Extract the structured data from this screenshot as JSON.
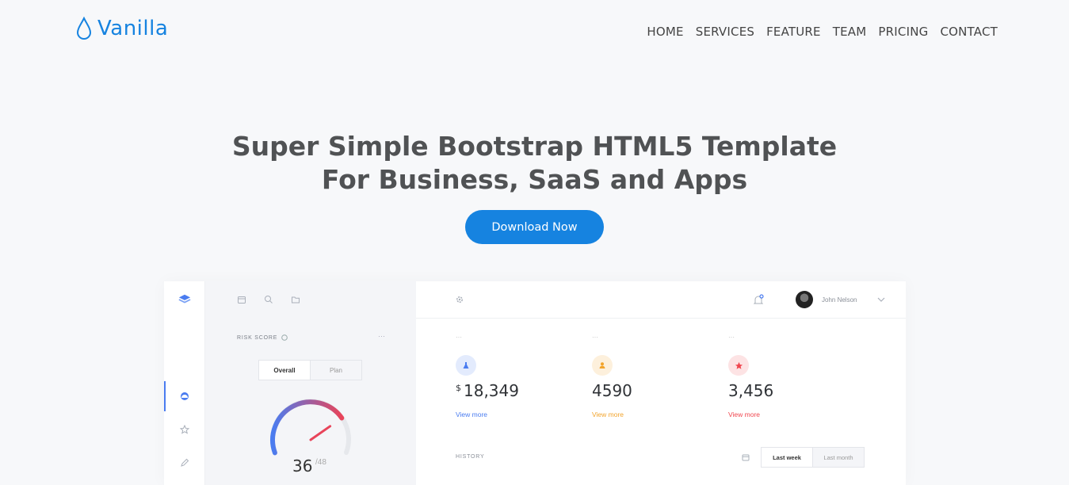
{
  "brand": {
    "name": "Vanilla",
    "color": "#1683e0"
  },
  "nav": {
    "items": [
      "HOME",
      "SERVICES",
      "FEATURE",
      "TEAM",
      "PRICING",
      "CONTACT"
    ]
  },
  "hero": {
    "title_line1": "Super Simple Bootstrap HTML5 Template",
    "title_line2": "For Business, SaaS and Apps",
    "cta_label": "Download Now"
  },
  "dashboard": {
    "rail_icons": [
      "layers-icon",
      "dashboard-icon",
      "star-icon",
      "pencil-icon"
    ],
    "toolbar_icons": [
      "calendar-icon",
      "search-icon",
      "folder-icon"
    ],
    "risk": {
      "label": "RISK SCORE",
      "dots": "···",
      "tabs": [
        "Overall",
        "Plan"
      ],
      "score": "36",
      "max": "/48",
      "level": 0.75
    },
    "user": {
      "name": "John Nelson"
    },
    "stats": [
      {
        "dots": "···",
        "currency": "$",
        "value": "18,349",
        "link": "View more",
        "icon": "flask-icon",
        "color": "#4a7cf0",
        "bg": "#e3ebfd"
      },
      {
        "dots": "···",
        "currency": "",
        "value": "4590",
        "link": "View more",
        "icon": "user-icon",
        "color": "#f2a42c",
        "bg": "#fdf0dc"
      },
      {
        "dots": "···",
        "currency": "",
        "value": "3,456",
        "link": "View more",
        "icon": "star-icon",
        "color": "#f0464f",
        "bg": "#fde3e4"
      }
    ],
    "history": {
      "label": "HISTORY",
      "tabs": [
        "Last week",
        "Last month"
      ]
    }
  }
}
